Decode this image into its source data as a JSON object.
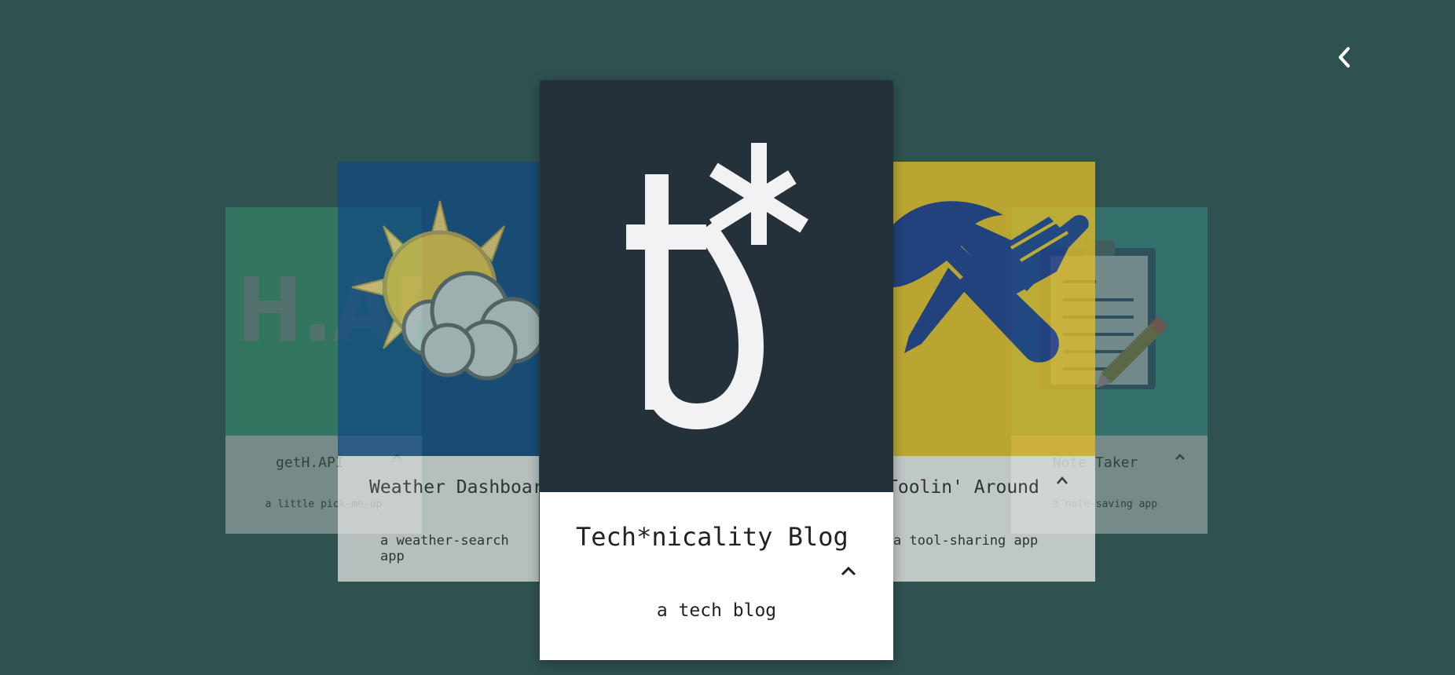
{
  "cards": [
    {
      "id": "geth",
      "title": "getH.API",
      "description": "a little pick-me-up",
      "logo_text": "H.API"
    },
    {
      "id": "weather",
      "title": "Weather Dashboard",
      "description": "a weather-search app"
    },
    {
      "id": "blog",
      "title": "Tech*nicality Blog",
      "description": "a tech blog"
    },
    {
      "id": "tool",
      "title": "Toolin' Around",
      "description": "a tool-sharing app"
    },
    {
      "id": "note",
      "title": "Note Taker",
      "description": "a note-saving app"
    }
  ],
  "icons": {
    "back": "chevron-left-icon",
    "expand": "chevron-up-icon"
  },
  "colors": {
    "background": "#2f5250",
    "geth": "#3cb07a",
    "weather": "#104a82",
    "blog": "#24313a",
    "tool": "#e2bd2a",
    "note": "#3da59a"
  }
}
